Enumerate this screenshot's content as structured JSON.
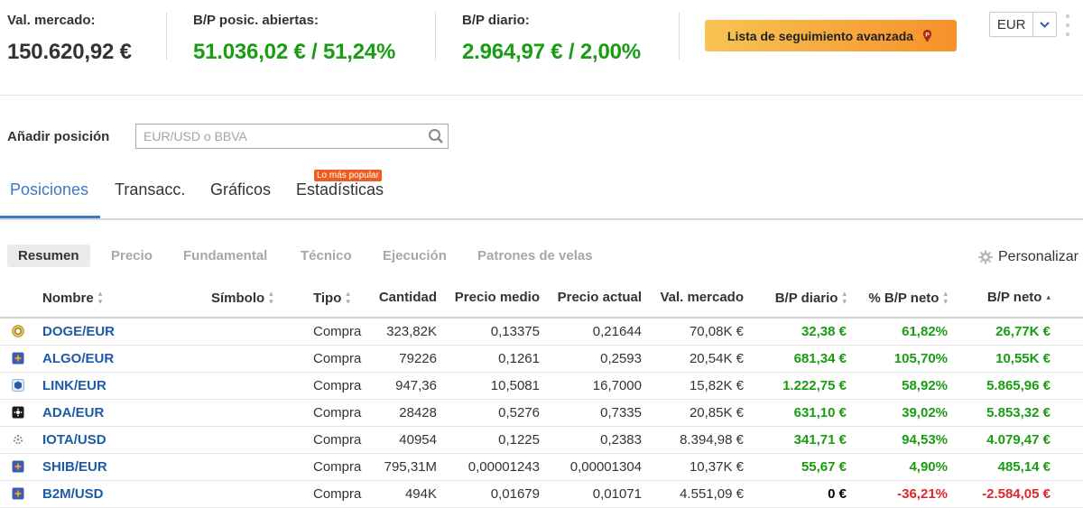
{
  "summary": {
    "market_value": {
      "label": "Val. mercado:",
      "value": "150.620,92 €"
    },
    "open_pl": {
      "label": "B/P posic. abiertas:",
      "value": "51.036,02 € / 51,24%"
    },
    "daily_pl": {
      "label": "B/P diario:",
      "value": "2.964,97 € / 2,00%"
    },
    "watchlist_button": "Lista de seguimiento avanzada",
    "currency": "EUR"
  },
  "add_position": {
    "label": "Añadir posición",
    "placeholder": "EUR/USD o BBVA"
  },
  "tabs": {
    "positions": "Posiciones",
    "transactions": "Transacc.",
    "charts": "Gráficos",
    "stats": "Estadísticas",
    "popular_badge": "Lo más popular"
  },
  "subtabs": {
    "summary": "Resumen",
    "price": "Precio",
    "fundamental": "Fundamental",
    "technical": "Técnico",
    "execution": "Ejecución",
    "candles": "Patrones de velas",
    "personalize": "Personalizar"
  },
  "table": {
    "columns": {
      "name": "Nombre",
      "symbol": "Símbolo",
      "type": "Tipo",
      "quantity": "Cantidad",
      "avg_price": "Precio medio",
      "current_price": "Precio actual",
      "market_value": "Val. mercado",
      "daily_pl": "B/P diario",
      "net_pl_pct": "% B/P neto",
      "net_pl": "B/P neto"
    },
    "rows": [
      {
        "name": "DOGE/EUR",
        "symbol": "",
        "type": "Compra",
        "quantity": "323,82K",
        "avg_price": "0,13375",
        "current_price": "0,21644",
        "market_value": "70,08K €",
        "daily_pl": "32,38 €",
        "net_pl_pct": "61,82%",
        "net_pl": "26,77K €",
        "daily_sign": "pos",
        "net_sign": "pos",
        "icon": "dogecoin-icon"
      },
      {
        "name": "ALGO/EUR",
        "symbol": "",
        "type": "Compra",
        "quantity": "79226",
        "avg_price": "0,1261",
        "current_price": "0,2593",
        "market_value": "20,54K €",
        "daily_pl": "681,34 €",
        "net_pl_pct": "105,70%",
        "net_pl": "10,55K €",
        "daily_sign": "pos",
        "net_sign": "pos",
        "icon": "generic-coin-icon"
      },
      {
        "name": "LINK/EUR",
        "symbol": "",
        "type": "Compra",
        "quantity": "947,36",
        "avg_price": "10,5081",
        "current_price": "16,7000",
        "market_value": "15,82K €",
        "daily_pl": "1.222,75 €",
        "net_pl_pct": "58,92%",
        "net_pl": "5.865,96 €",
        "daily_sign": "pos",
        "net_sign": "pos",
        "icon": "chainlink-icon"
      },
      {
        "name": "ADA/EUR",
        "symbol": "",
        "type": "Compra",
        "quantity": "28428",
        "avg_price": "0,5276",
        "current_price": "0,7335",
        "market_value": "20,85K €",
        "daily_pl": "631,10 €",
        "net_pl_pct": "39,02%",
        "net_pl": "5.853,32 €",
        "daily_sign": "pos",
        "net_sign": "pos",
        "icon": "cardano-icon"
      },
      {
        "name": "IOTA/USD",
        "symbol": "",
        "type": "Compra",
        "quantity": "40954",
        "avg_price": "0,1225",
        "current_price": "0,2383",
        "market_value": "8.394,98 €",
        "daily_pl": "341,71 €",
        "net_pl_pct": "94,53%",
        "net_pl": "4.079,47 €",
        "daily_sign": "pos",
        "net_sign": "pos",
        "icon": "iota-icon"
      },
      {
        "name": "SHIB/EUR",
        "symbol": "",
        "type": "Compra",
        "quantity": "795,31M",
        "avg_price": "0,00001243",
        "current_price": "0,00001304",
        "market_value": "10,37K €",
        "daily_pl": "55,67 €",
        "net_pl_pct": "4,90%",
        "net_pl": "485,14 €",
        "daily_sign": "pos",
        "net_sign": "pos",
        "icon": "generic-coin-icon"
      },
      {
        "name": "B2M/USD",
        "symbol": "",
        "type": "Compra",
        "quantity": "494K",
        "avg_price": "0,01679",
        "current_price": "0,01071",
        "market_value": "4.551,09 €",
        "daily_pl": "0 €",
        "net_pl_pct": "-36,21%",
        "net_pl": "-2.584,05 €",
        "daily_sign": "zero",
        "net_sign": "neg",
        "icon": "generic-coin-icon"
      }
    ]
  },
  "colors": {
    "accent_blue": "#3f77c8",
    "link_blue": "#1f5aa6",
    "positive": "#1a9c12",
    "negative": "#e0262b",
    "badge_orange": "#ee5d1e",
    "watch_btn_start": "#f7c454",
    "watch_btn_end": "#f6912a"
  },
  "icons": [
    "caret-down-icon",
    "kebab-menu-icon",
    "search-icon",
    "gear-icon",
    "sort-icon"
  ]
}
